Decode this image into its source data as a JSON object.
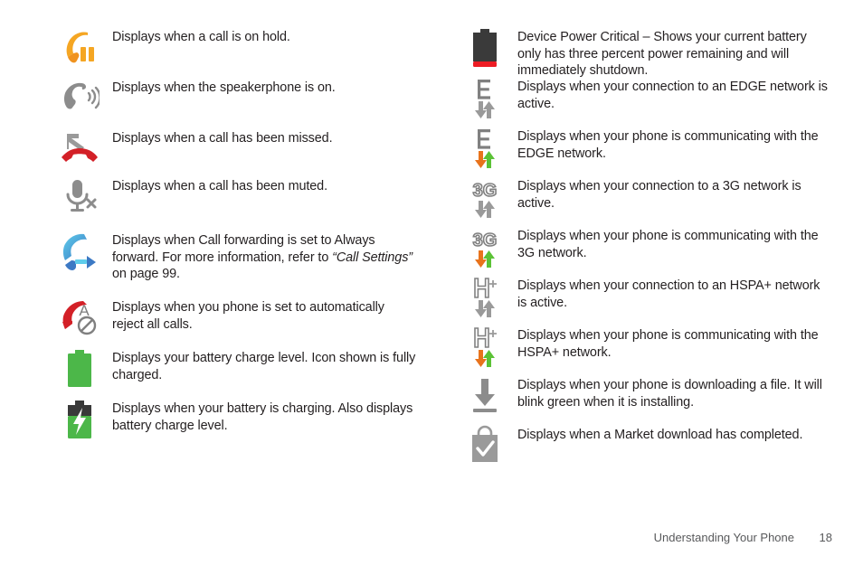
{
  "document": {
    "footer_title": "Understanding Your Phone",
    "footer_page": "18"
  },
  "colors": {
    "orange": "#F5A623",
    "orange_dark": "#E8731C",
    "gray": "#8C8C8C",
    "gray_dark": "#757575",
    "red": "#D32027",
    "green": "#4CB749",
    "green_bright": "#5BC236",
    "blue": "#3FA9D8",
    "blue_dark": "#3C79C4",
    "battery_dark": "#3A3A3A",
    "text": "#231f20"
  },
  "left_column": {
    "rows": [
      {
        "icon": "call-on-hold-icon",
        "text": "Displays when a call is on hold."
      },
      {
        "icon": "speakerphone-on-icon",
        "text": "Displays when the speakerphone is on."
      },
      {
        "icon": "missed-call-icon",
        "text": "Displays when a call has been missed."
      },
      {
        "icon": "call-muted-icon",
        "text": "Displays when a call has been muted."
      },
      {
        "icon": "call-forwarding-icon",
        "text_before": "Displays when Call forwarding is set to Always forward. For more information, refer to ",
        "text_italic": "“Call Settings”",
        "text_after": " on page 99."
      },
      {
        "icon": "auto-reject-call-icon",
        "text": "Displays when you phone is set to automatically reject all calls."
      },
      {
        "icon": "battery-full-icon",
        "text": "Displays your battery charge level. Icon shown is fully charged."
      },
      {
        "icon": "battery-charging-icon",
        "text": "Displays when your battery is charging. Also displays battery charge level."
      }
    ]
  },
  "right_column": {
    "rows": [
      {
        "icon": "battery-critical-icon",
        "text": "Device Power Critical – Shows your current battery only has three percent power remaining and will immediately shutdown."
      },
      {
        "icon": "edge-network-active-icon",
        "text": "Displays when your connection to an EDGE network is active."
      },
      {
        "icon": "edge-network-transfer-icon",
        "text": "Displays when your phone is communicating with the EDGE network."
      },
      {
        "icon": "3g-network-active-icon",
        "text": "Displays when your connection to a 3G network is active."
      },
      {
        "icon": "3g-network-transfer-icon",
        "text": "Displays when your phone is communicating with the 3G network."
      },
      {
        "icon": "hspa-network-active-icon",
        "text": "Displays when your connection to an HSPA+ network is active."
      },
      {
        "icon": "hspa-network-transfer-icon",
        "text": "Displays when your phone is communicating with the HSPA+ network."
      },
      {
        "icon": "download-in-progress-icon",
        "text": "Displays when your phone is downloading a file. It will blink green when it is installing."
      },
      {
        "icon": "market-download-complete-icon",
        "text": "Displays when a Market download has completed."
      }
    ]
  }
}
